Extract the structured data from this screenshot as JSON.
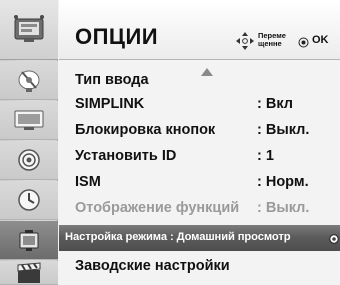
{
  "header": {
    "title": "ОПЦИИ",
    "move_hint": "Переме щенне",
    "ok_hint": "OK"
  },
  "sidebar": {
    "items": [
      {
        "icon": "options-tv-icon"
      },
      {
        "icon": "antenna-dish-icon"
      },
      {
        "icon": "picture-screen-icon"
      },
      {
        "icon": "audio-speaker-icon"
      },
      {
        "icon": "clock-icon"
      },
      {
        "icon": "options-lock-icon",
        "active": true
      },
      {
        "icon": "clapperboard-icon"
      }
    ]
  },
  "menu": {
    "items": [
      {
        "label": "Тип ввода",
        "value": ""
      },
      {
        "label": "SIMPLINK",
        "value": ": Вкл"
      },
      {
        "label": "Блокировка кнопок",
        "value": ": Выкл."
      },
      {
        "label": "Установить ID",
        "value": ": 1"
      },
      {
        "label": "ISM",
        "value": ": Норм."
      },
      {
        "label": "Отображение функций",
        "value": ": Выкл.",
        "disabled": true
      },
      {
        "label": "Настройка режима : Домашний просмотр",
        "selected": true
      },
      {
        "label": "Заводские настройки",
        "value": ""
      }
    ]
  }
}
